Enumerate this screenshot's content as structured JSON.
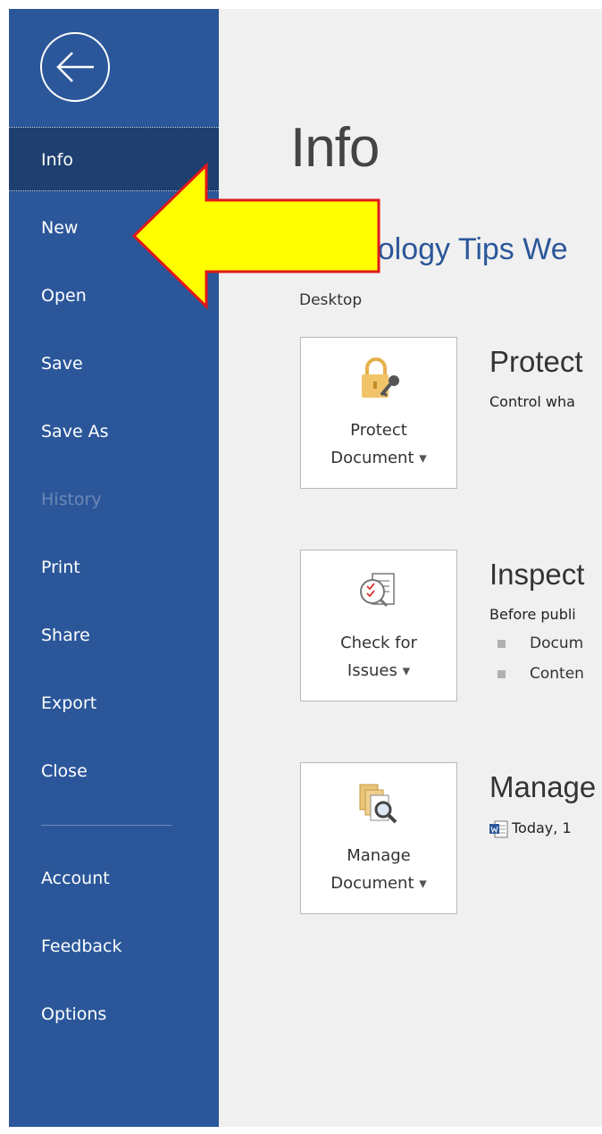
{
  "sidebar": {
    "items": [
      {
        "label": "Info"
      },
      {
        "label": "New"
      },
      {
        "label": "Open"
      },
      {
        "label": "Save"
      },
      {
        "label": "Save As"
      },
      {
        "label": "History"
      },
      {
        "label": "Print"
      },
      {
        "label": "Share"
      },
      {
        "label": "Export"
      },
      {
        "label": "Close"
      },
      {
        "label": "Account"
      },
      {
        "label": "Feedback"
      },
      {
        "label": "Options"
      }
    ],
    "active": "Info",
    "disabled": "History",
    "back_icon": "back-arrow-icon"
  },
  "main": {
    "title": "Info",
    "doc_title": "Technology Tips We",
    "location": "Desktop",
    "protect": {
      "tile_line1": "Protect",
      "tile_line2": "Document",
      "heading": "Protect",
      "desc": "Control wha",
      "icon": "lock-key-icon"
    },
    "inspect": {
      "tile_line1": "Check for",
      "tile_line2": "Issues",
      "heading": "Inspect",
      "desc": "Before publi",
      "bullets": [
        "Docum",
        "Conten"
      ],
      "icon": "check-issues-icon"
    },
    "manage": {
      "tile_line1": "Manage",
      "tile_line2": "Document",
      "heading": "Manage",
      "file_text": "Today, 1",
      "icon": "manage-document-icon"
    }
  },
  "annotation": {
    "color": "#ffff00",
    "outline": "#e0171b",
    "icon": "yellow-arrow-icon"
  },
  "colors": {
    "sidebar": "#2b579a",
    "sidebar_active": "#1e3f6f",
    "accent": "#2b579a"
  }
}
